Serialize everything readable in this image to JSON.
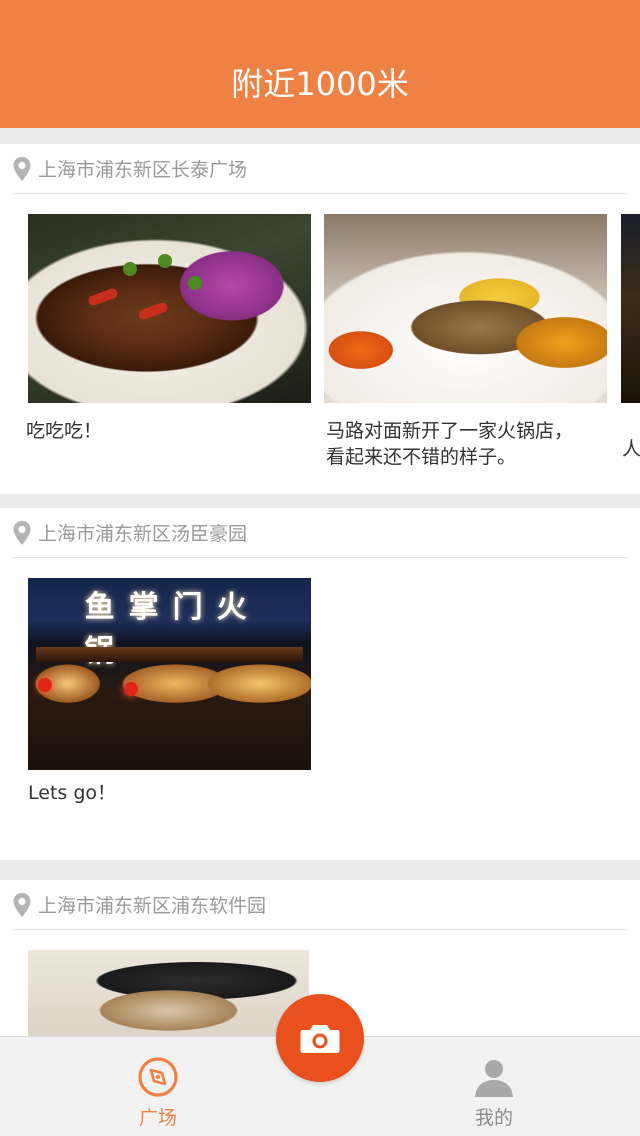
{
  "header": {
    "title": "附近1000米"
  },
  "posts": [
    {
      "location": "上海市浦东新区长泰广场",
      "items": [
        {
          "caption": "吃吃吃！",
          "photo": "food-dish-clams"
        },
        {
          "caption_lines": [
            "马路对面新开了一家火锅店，",
            "看起来还不错的样子。"
          ],
          "photo": "food-platter-corn-sweet-potato"
        },
        {
          "caption": "人",
          "photo": "food-dark-partial"
        }
      ]
    },
    {
      "location": "上海市浦东新区汤臣豪园",
      "items": [
        {
          "caption": "Lets go！",
          "photo": "hotpot-restaurant-night",
          "sign": "鱼掌门火锅"
        }
      ]
    },
    {
      "location": "上海市浦东新区浦东软件园",
      "items": [
        {
          "caption": "",
          "photo": "food-bowl-rice"
        }
      ]
    }
  ],
  "tabbar": {
    "tabs": [
      {
        "label": "广场",
        "icon": "compass-icon",
        "active": true
      },
      {
        "label": "我的",
        "icon": "user-icon",
        "active": false
      }
    ],
    "camera_icon": "camera-icon"
  },
  "colors": {
    "accent": "#f08145",
    "camera": "#e8501e",
    "location_text": "#9a9a9a"
  }
}
